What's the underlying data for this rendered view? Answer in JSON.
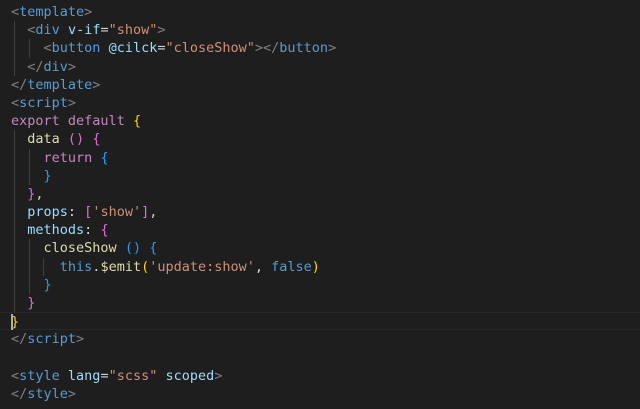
{
  "colors": {
    "background": "#1e1e1e",
    "tag_bracket": "#808080",
    "tag_name": "#569cd6",
    "attribute": "#9cdcfe",
    "string": "#ce9178",
    "keyword": "#c586c0",
    "function": "#dcdcaa",
    "property": "#9cdcfe",
    "plain": "#d4d4d4",
    "bracket_gold": "#ffd700",
    "bracket_pink": "#da70d6",
    "bracket_blue": "#179fff",
    "boolean": "#569cd6"
  },
  "cursor_line": 18,
  "lines": [
    {
      "indent": 0,
      "tokens": [
        {
          "t": "<",
          "c": "tag_bracket"
        },
        {
          "t": "template",
          "c": "tag_name"
        },
        {
          "t": ">",
          "c": "tag_bracket"
        }
      ]
    },
    {
      "indent": 1,
      "tokens": [
        {
          "t": "<",
          "c": "tag_bracket"
        },
        {
          "t": "div",
          "c": "tag_name"
        },
        {
          "t": " ",
          "c": "plain"
        },
        {
          "t": "v-if",
          "c": "attribute"
        },
        {
          "t": "=",
          "c": "plain"
        },
        {
          "t": "\"show\"",
          "c": "string"
        },
        {
          "t": ">",
          "c": "tag_bracket"
        }
      ]
    },
    {
      "indent": 2,
      "tokens": [
        {
          "t": "<",
          "c": "tag_bracket"
        },
        {
          "t": "button",
          "c": "tag_name"
        },
        {
          "t": " ",
          "c": "plain"
        },
        {
          "t": "@cilck",
          "c": "attribute"
        },
        {
          "t": "=",
          "c": "plain"
        },
        {
          "t": "\"closeShow\"",
          "c": "string"
        },
        {
          "t": "></",
          "c": "tag_bracket"
        },
        {
          "t": "button",
          "c": "tag_name"
        },
        {
          "t": ">",
          "c": "tag_bracket"
        }
      ]
    },
    {
      "indent": 1,
      "tokens": [
        {
          "t": "</",
          "c": "tag_bracket"
        },
        {
          "t": "div",
          "c": "tag_name"
        },
        {
          "t": ">",
          "c": "tag_bracket"
        }
      ]
    },
    {
      "indent": 0,
      "tokens": [
        {
          "t": "</",
          "c": "tag_bracket"
        },
        {
          "t": "template",
          "c": "tag_name"
        },
        {
          "t": ">",
          "c": "tag_bracket"
        }
      ]
    },
    {
      "indent": 0,
      "tokens": [
        {
          "t": "<",
          "c": "tag_bracket"
        },
        {
          "t": "script",
          "c": "tag_name"
        },
        {
          "t": ">",
          "c": "tag_bracket"
        }
      ]
    },
    {
      "indent": 0,
      "tokens": [
        {
          "t": "export",
          "c": "keyword"
        },
        {
          "t": " ",
          "c": "plain"
        },
        {
          "t": "default",
          "c": "keyword"
        },
        {
          "t": " ",
          "c": "plain"
        },
        {
          "t": "{",
          "c": "bracket_gold"
        }
      ]
    },
    {
      "indent": 1,
      "tokens": [
        {
          "t": "data",
          "c": "function"
        },
        {
          "t": " ",
          "c": "plain"
        },
        {
          "t": "()",
          "c": "bracket_pink"
        },
        {
          "t": " ",
          "c": "plain"
        },
        {
          "t": "{",
          "c": "bracket_pink"
        }
      ]
    },
    {
      "indent": 2,
      "tokens": [
        {
          "t": "return",
          "c": "keyword"
        },
        {
          "t": " ",
          "c": "plain"
        },
        {
          "t": "{",
          "c": "bracket_blue"
        }
      ]
    },
    {
      "indent": 2,
      "tokens": [
        {
          "t": "}",
          "c": "bracket_blue"
        }
      ]
    },
    {
      "indent": 1,
      "tokens": [
        {
          "t": "}",
          "c": "bracket_pink"
        },
        {
          "t": ",",
          "c": "plain"
        }
      ]
    },
    {
      "indent": 1,
      "tokens": [
        {
          "t": "props",
          "c": "property"
        },
        {
          "t": ": ",
          "c": "plain"
        },
        {
          "t": "[",
          "c": "bracket_pink"
        },
        {
          "t": "'show'",
          "c": "string"
        },
        {
          "t": "]",
          "c": "bracket_pink"
        },
        {
          "t": ",",
          "c": "plain"
        }
      ]
    },
    {
      "indent": 1,
      "tokens": [
        {
          "t": "methods",
          "c": "property"
        },
        {
          "t": ": ",
          "c": "plain"
        },
        {
          "t": "{",
          "c": "bracket_pink"
        }
      ]
    },
    {
      "indent": 2,
      "tokens": [
        {
          "t": "closeShow",
          "c": "function"
        },
        {
          "t": " ",
          "c": "plain"
        },
        {
          "t": "()",
          "c": "bracket_blue"
        },
        {
          "t": " ",
          "c": "plain"
        },
        {
          "t": "{",
          "c": "bracket_blue"
        }
      ]
    },
    {
      "indent": 3,
      "tokens": [
        {
          "t": "this",
          "c": "boolean"
        },
        {
          "t": ".",
          "c": "plain"
        },
        {
          "t": "$emit",
          "c": "function"
        },
        {
          "t": "(",
          "c": "bracket_gold"
        },
        {
          "t": "'update:show'",
          "c": "string"
        },
        {
          "t": ", ",
          "c": "plain"
        },
        {
          "t": "false",
          "c": "boolean"
        },
        {
          "t": ")",
          "c": "bracket_gold"
        }
      ]
    },
    {
      "indent": 2,
      "tokens": [
        {
          "t": "}",
          "c": "bracket_blue"
        }
      ]
    },
    {
      "indent": 1,
      "tokens": [
        {
          "t": "}",
          "c": "bracket_pink"
        }
      ]
    },
    {
      "indent": 0,
      "tokens": [
        {
          "t": "}",
          "c": "bracket_gold"
        }
      ]
    },
    {
      "indent": 0,
      "tokens": [
        {
          "t": "</",
          "c": "tag_bracket"
        },
        {
          "t": "script",
          "c": "tag_name"
        },
        {
          "t": ">",
          "c": "tag_bracket"
        }
      ]
    },
    {
      "indent": 0,
      "tokens": []
    },
    {
      "indent": 0,
      "tokens": [
        {
          "t": "<",
          "c": "tag_bracket"
        },
        {
          "t": "style",
          "c": "tag_name"
        },
        {
          "t": " ",
          "c": "plain"
        },
        {
          "t": "lang",
          "c": "attribute"
        },
        {
          "t": "=",
          "c": "plain"
        },
        {
          "t": "\"scss\"",
          "c": "string"
        },
        {
          "t": " ",
          "c": "plain"
        },
        {
          "t": "scoped",
          "c": "attribute"
        },
        {
          "t": ">",
          "c": "tag_bracket"
        }
      ]
    },
    {
      "indent": 0,
      "tokens": [
        {
          "t": "</",
          "c": "tag_bracket"
        },
        {
          "t": "style",
          "c": "tag_name"
        },
        {
          "t": ">",
          "c": "tag_bracket"
        }
      ]
    }
  ]
}
